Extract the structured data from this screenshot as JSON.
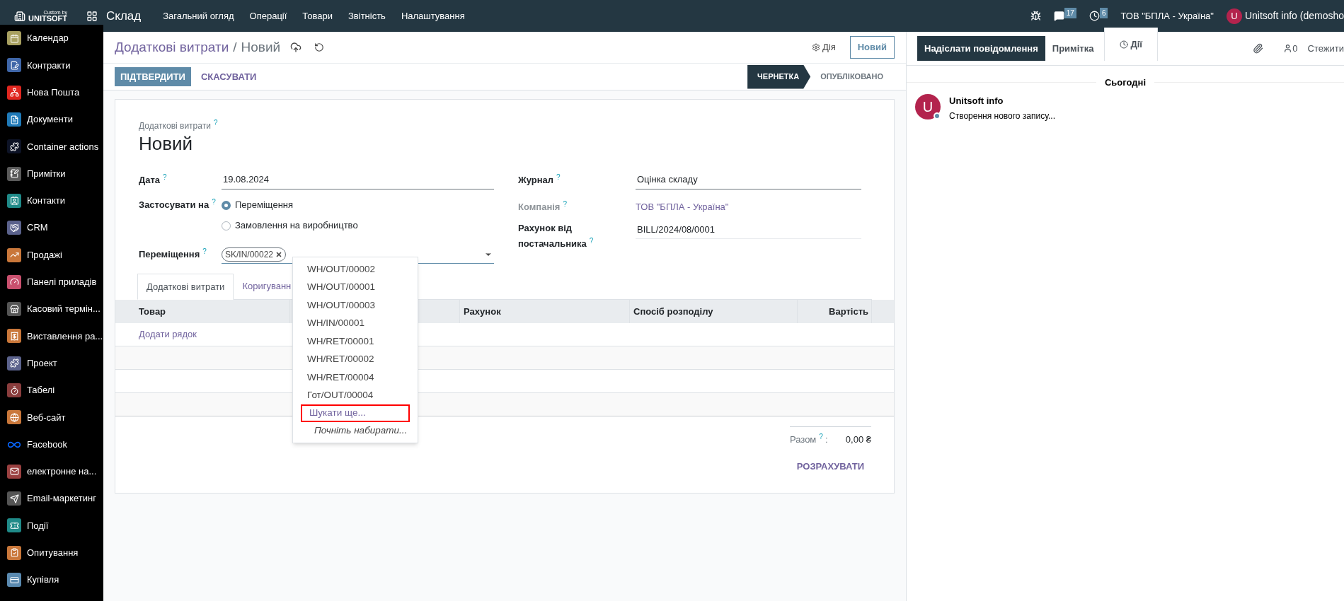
{
  "topbar": {
    "logo_top": "Custom by",
    "logo_bottom": "UNITSOFT",
    "app": "Склад",
    "menu": [
      "Загальний огляд",
      "Операції",
      "Товари",
      "Звітність",
      "Налаштування"
    ],
    "chat_count": "17",
    "activity_count": "6",
    "company": "ТОВ \"БПЛА - Україна\"",
    "avatar_letter": "U",
    "user": "Unitsoft info (demosho"
  },
  "sidebar": {
    "items": [
      {
        "label": "Календар",
        "color": "#a8a060",
        "kind": "tile"
      },
      {
        "label": "Контракти",
        "color": "#3f66a8",
        "kind": "tile"
      },
      {
        "label": "Нова Пошта",
        "color": "#e0261f",
        "kind": "tile"
      },
      {
        "label": "Документи",
        "color": "#1f7ab8",
        "kind": "tile"
      },
      {
        "label": "Container actions",
        "color": "#0d1326",
        "kind": "tile"
      },
      {
        "label": "Примітки",
        "color": "#5a5a5a",
        "kind": "tile"
      },
      {
        "label": "Контакти",
        "color": "#1f8a88",
        "kind": "tile"
      },
      {
        "label": "CRM",
        "color": "#5b628c",
        "kind": "tile"
      },
      {
        "label": "Продажі",
        "color": "#c9773a",
        "kind": "tile"
      },
      {
        "label": "Панелі приладів",
        "color": "#c9506e",
        "kind": "tile"
      },
      {
        "label": "Касовий термін...",
        "color": "#555555",
        "kind": "tile"
      },
      {
        "label": "Виставлення ра...",
        "color": "#c9773a",
        "kind": "tile"
      },
      {
        "label": "Проект",
        "color": "#5b628c",
        "kind": "tile"
      },
      {
        "label": "Табелі",
        "color": "#8a3d3d",
        "kind": "tile"
      },
      {
        "label": "Веб-сайт",
        "color": "#c9773a",
        "kind": "tile"
      },
      {
        "label": "Facebook",
        "color": "#0866ff",
        "kind": "logo"
      },
      {
        "label": "електронне на...",
        "color": "#9a4040",
        "kind": "tile"
      },
      {
        "label": "Email-маркетинг",
        "color": "#555555",
        "kind": "tile"
      },
      {
        "label": "Події",
        "color": "#1f8a88",
        "kind": "tile"
      },
      {
        "label": "Опитування",
        "color": "#c9773a",
        "kind": "tile"
      },
      {
        "label": "Купівля",
        "color": "#5a8ab0",
        "kind": "tile"
      }
    ]
  },
  "breadcrumb": {
    "parent": "Додаткові витрати",
    "separator": "/",
    "current": "Новий"
  },
  "action_button": "Дія",
  "new_button": "Новий",
  "buttons": [
    {
      "label": "ПІДТВЕРДИТИ",
      "kind": "primary"
    },
    {
      "label": "СКАСУВАТИ",
      "kind": "link"
    }
  ],
  "status_steps": [
    {
      "label": "ЧЕРНЕТКА",
      "selected": true
    },
    {
      "label": "ОПУБЛІКОВАНО",
      "selected": false
    }
  ],
  "form": {
    "caption": "Додаткові витрати",
    "caption_help": "?",
    "title": "Новий",
    "date": {
      "label": "Дата",
      "help": "?",
      "value": "19.08.2024"
    },
    "apply_to": {
      "label": "Застосувати на",
      "help": "?",
      "options": [
        {
          "label": "Переміщення",
          "selected": true
        },
        {
          "label": "Замовлення на виробництво",
          "selected": false
        }
      ]
    },
    "transfers": {
      "label": "Переміщення",
      "help": "?",
      "tags": [
        "SK/IN/00022"
      ]
    },
    "journal": {
      "label": "Журнал",
      "help": "?",
      "value": "Оцінка складу"
    },
    "company": {
      "label": "Компанія",
      "help": "?",
      "value": "ТОВ \"БПЛА - Україна\""
    },
    "vendor_bill": {
      "label": "Рахунок від постачальника",
      "help": "?",
      "value": "BILL/2024/08/0001"
    }
  },
  "tabs": [
    {
      "label": "Додаткові витрати",
      "selected": true
    },
    {
      "label": "Коригуванн",
      "selected": false
    }
  ],
  "table": {
    "columns": [
      "Товар",
      "Рахунок",
      "Спосіб розподілу",
      "Вартість"
    ],
    "add_line": "Додати рядок"
  },
  "total": {
    "label": "Разом",
    "help": "?",
    "separator": ":",
    "value": "0,00 ₴"
  },
  "compute_button": "РОЗРАХУВАТИ",
  "dropdown": {
    "items": [
      "WH/OUT/00002",
      "WH/OUT/00001",
      "WH/OUT/00003",
      "WH/IN/00001",
      "WH/RET/00001",
      "WH/RET/00002",
      "WH/RET/00004",
      "Гот/OUT/00004"
    ],
    "search_more": "Шукати ще...",
    "hint": "Почніть набирати..."
  },
  "chatter": {
    "buttons": [
      {
        "label": "Надіслати повідомлення",
        "kind": "message",
        "selected": true
      },
      {
        "label": "Примітка",
        "kind": "note",
        "selected": false
      },
      {
        "label": "Дії",
        "kind": "activity",
        "selected": false
      }
    ],
    "followers_count": "0",
    "follow": "Стежити",
    "date_divider": "Сьогодні",
    "messages": [
      {
        "author": "Unitsoft info",
        "avatar_letter": "U",
        "text": "Створення нового запису..."
      }
    ]
  }
}
